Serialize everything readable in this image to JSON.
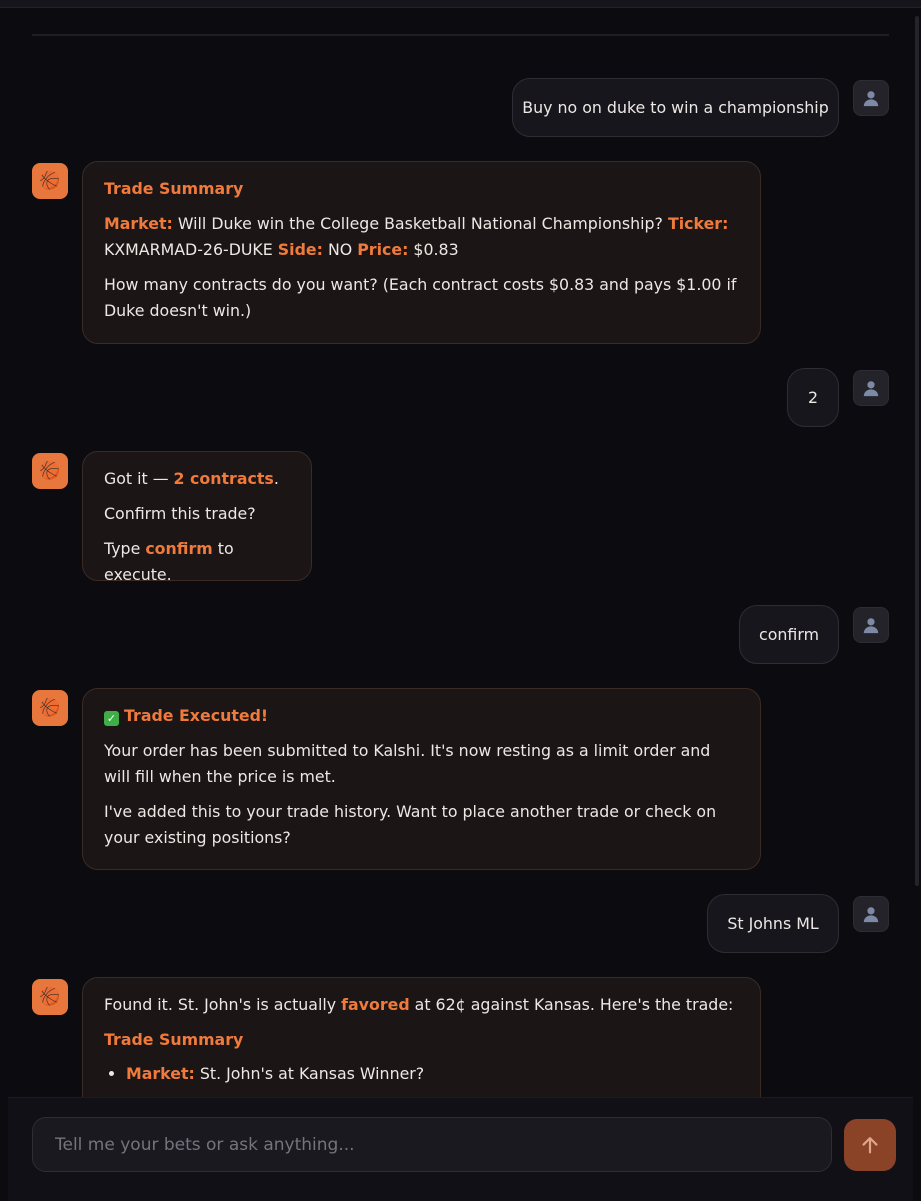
{
  "composer": {
    "placeholder": "Tell me your bets or ask anything..."
  },
  "messages": {
    "m1": {
      "text": "Buy no on duke to win a championship"
    },
    "m2": {
      "title": "Trade Summary",
      "market_label": "Market:",
      "market_value": " Will Duke win the College Basketball National Championship? ",
      "ticker_label": "Ticker:",
      "ticker_value": " KXMARMAD-26-DUKE ",
      "side_label": "Side:",
      "side_value": " NO ",
      "price_label": "Price:",
      "price_value": " $0.83",
      "question": "How many contracts do you want? (Each contract costs $0.83 and pays $1.00 if Duke doesn't win.)"
    },
    "m3": {
      "text": "2"
    },
    "m4": {
      "got_it": "Got it — ",
      "contracts": "2 contracts",
      "period": ".",
      "confirm_question": "Confirm this trade?",
      "type_prefix": "Type ",
      "confirm_word": "confirm",
      "type_suffix": " to execute."
    },
    "m5": {
      "text": "confirm"
    },
    "m6": {
      "check": "✓",
      "title": "Trade Executed!",
      "body1": "Your order has been submitted to Kalshi. It's now resting as a limit order and will fill when the price is met.",
      "body2": "I've added this to your trade history. Want to place another trade or check on your existing positions?"
    },
    "m7": {
      "text": "St Johns ML"
    },
    "m8": {
      "intro_prefix": "Found it. St. John's is actually ",
      "favored": "favored",
      "intro_suffix": " at 62¢ against Kansas. Here's the trade:",
      "title": "Trade Summary",
      "market_label": "Market:",
      "market_value": " St. John's at Kansas Winner?"
    }
  },
  "icons": {
    "bot_avatar": "basketball-icon",
    "user_avatar": "user-icon",
    "send": "arrow-up-icon"
  },
  "colors": {
    "accent": "#ef7a3c",
    "bot_avatar_bg": "#e8773d",
    "send_button_bg": "#8a4327"
  }
}
